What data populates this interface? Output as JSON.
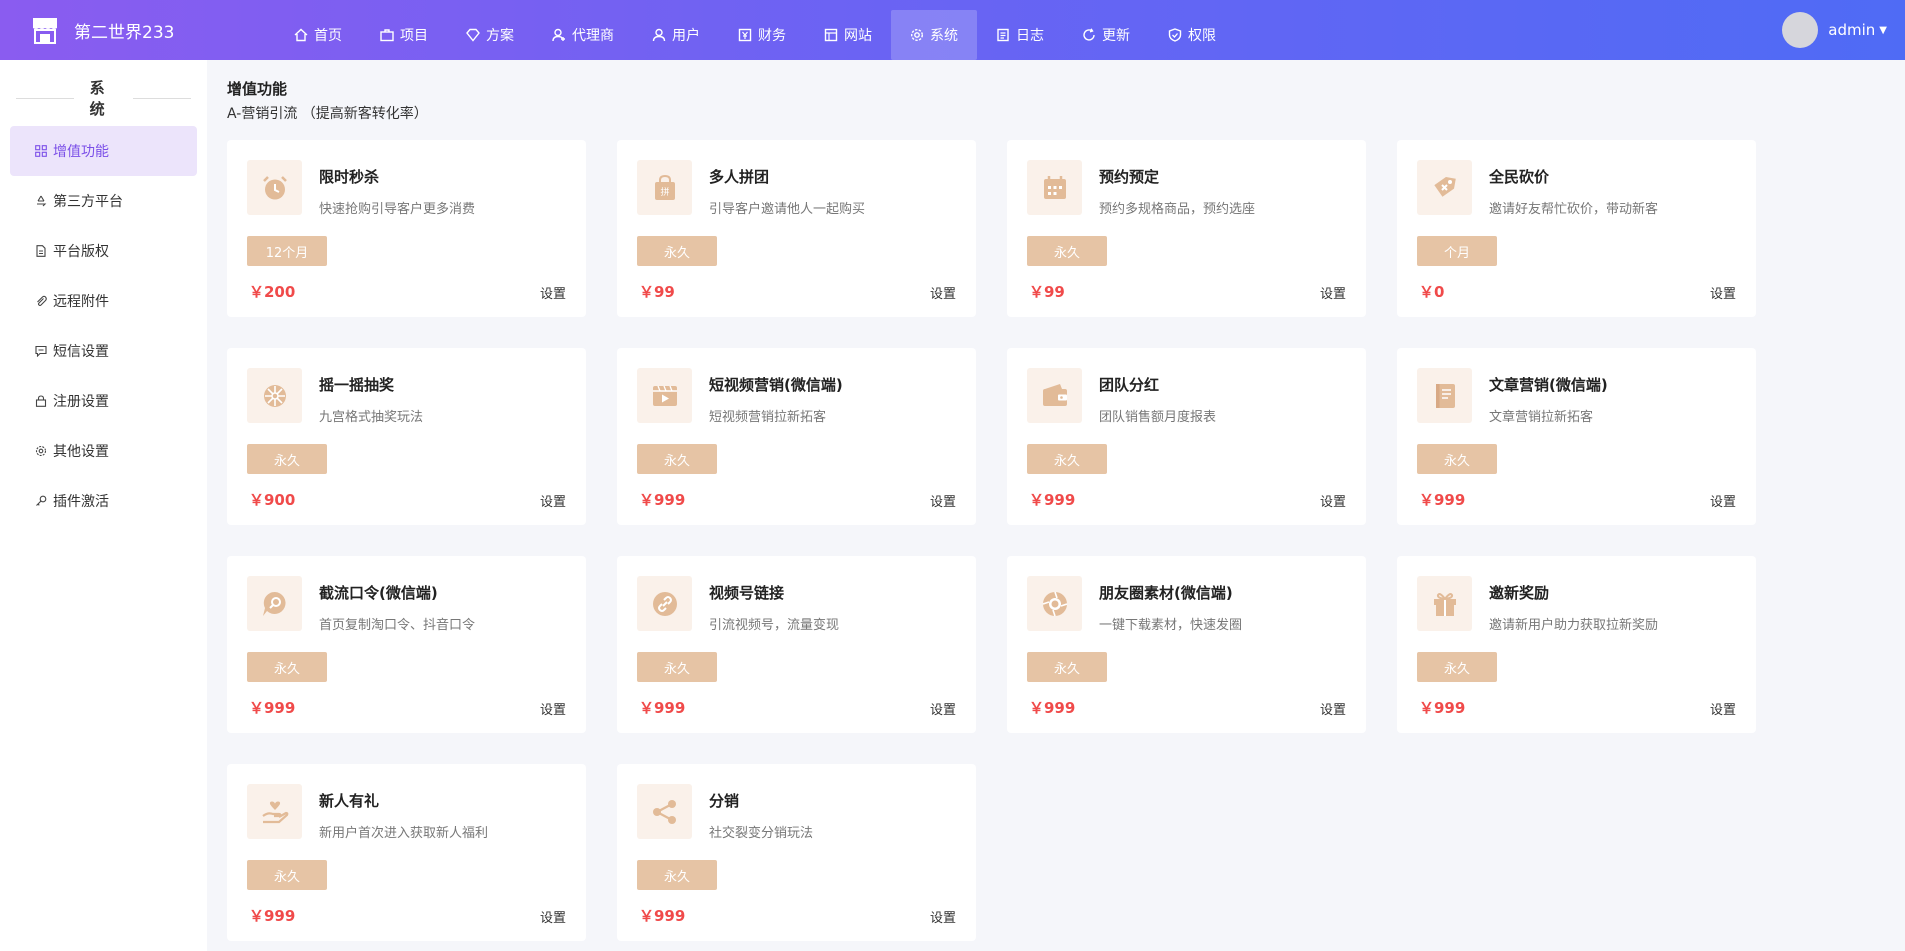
{
  "header": {
    "brand": "第二世界233",
    "nav": [
      {
        "label": "首页",
        "icon": "home-icon"
      },
      {
        "label": "项目",
        "icon": "briefcase-icon"
      },
      {
        "label": "方案",
        "icon": "diamond-icon"
      },
      {
        "label": "代理商",
        "icon": "agent-icon"
      },
      {
        "label": "用户",
        "icon": "users-icon"
      },
      {
        "label": "财务",
        "icon": "finance-icon"
      },
      {
        "label": "网站",
        "icon": "website-icon"
      },
      {
        "label": "系统",
        "icon": "gear-icon",
        "active": true
      },
      {
        "label": "日志",
        "icon": "log-icon"
      },
      {
        "label": "更新",
        "icon": "refresh-icon"
      },
      {
        "label": "权限",
        "icon": "shield-icon"
      }
    ],
    "user": "admin"
  },
  "sidebar": {
    "title": "系统",
    "items": [
      {
        "label": "增值功能",
        "icon": "grid-icon",
        "active": true
      },
      {
        "label": "第三方平台",
        "icon": "recycle-icon"
      },
      {
        "label": "平台版权",
        "icon": "file-icon"
      },
      {
        "label": "远程附件",
        "icon": "paperclip-icon"
      },
      {
        "label": "短信设置",
        "icon": "message-icon"
      },
      {
        "label": "注册设置",
        "icon": "lock-icon"
      },
      {
        "label": "其他设置",
        "icon": "gear-icon"
      },
      {
        "label": "插件激活",
        "icon": "key-icon"
      }
    ]
  },
  "main": {
    "title": "增值功能",
    "subtitle": "A-营销引流 （提高新客转化率）",
    "setting_label": "设置",
    "cards": [
      {
        "name": "限时秒杀",
        "desc": "快速抢购引导客户更多消费",
        "badge": "12个月",
        "price": "￥200",
        "icon": "alarm-clock-icon"
      },
      {
        "name": "多人拼团",
        "desc": "引导客户邀请他人一起购买",
        "badge": "永久",
        "price": "￥99",
        "icon": "shopping-bag-icon"
      },
      {
        "name": "预约预定",
        "desc": "预约多规格商品，预约选座",
        "badge": "永久",
        "price": "￥99",
        "icon": "calendar-icon"
      },
      {
        "name": "全民砍价",
        "desc": "邀请好友帮忙砍价，带动新客",
        "badge": "个月",
        "price": "￥0",
        "icon": "price-tag-icon"
      },
      {
        "name": "摇一摇抽奖",
        "desc": "九宫格式抽奖玩法",
        "badge": "永久",
        "price": "￥900",
        "icon": "lottery-wheel-icon"
      },
      {
        "name": "短视频营销(微信端)",
        "desc": "短视频营销拉新拓客",
        "badge": "永久",
        "price": "￥999",
        "icon": "video-icon"
      },
      {
        "name": "团队分红",
        "desc": "团队销售额月度报表",
        "badge": "永久",
        "price": "￥999",
        "icon": "wallet-icon"
      },
      {
        "name": "文章营销(微信端)",
        "desc": "文章营销拉新拓客",
        "badge": "永久",
        "price": "￥999",
        "icon": "document-icon"
      },
      {
        "name": "截流口令(微信端)",
        "desc": "首页复制淘口令、抖音口令",
        "badge": "永久",
        "price": "￥999",
        "icon": "search-chat-icon"
      },
      {
        "name": "视频号链接",
        "desc": "引流视频号，流量变现",
        "badge": "永久",
        "price": "￥999",
        "icon": "link-icon"
      },
      {
        "name": "朋友圈素材(微信端)",
        "desc": "一键下载素材，快速发圈",
        "badge": "永久",
        "price": "￥999",
        "icon": "camera-aperture-icon"
      },
      {
        "name": "邀新奖励",
        "desc": "邀请新用户助力获取拉新奖励",
        "badge": "永久",
        "price": "￥999",
        "icon": "gift-icon"
      },
      {
        "name": "新人有礼",
        "desc": "新用户首次进入获取新人福利",
        "badge": "永久",
        "price": "￥999",
        "icon": "hand-heart-icon"
      },
      {
        "name": "分销",
        "desc": "社交裂变分销玩法",
        "badge": "永久",
        "price": "￥999",
        "icon": "share-icon"
      }
    ]
  },
  "colors": {
    "header_gradient_start": "#8a5cf0",
    "header_gradient_end": "#4f6bf5",
    "accent": "#7b4fe8",
    "badge": "#e6c4a5",
    "icon_tint": "#e2bb98",
    "price": "#f04a4a"
  }
}
